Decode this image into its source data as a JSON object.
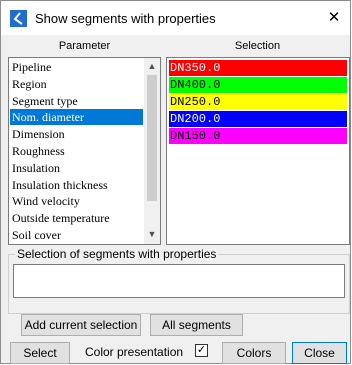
{
  "window": {
    "title": "Show segments with properties",
    "close_glyph": "✕"
  },
  "headers": {
    "parameter": "Parameter",
    "selection": "Selection"
  },
  "parameters": [
    "Pipeline",
    "Region",
    "Segment type",
    "Nom. diameter",
    "Dimension",
    "Roughness",
    "Insulation",
    "Insulation thickness",
    "Wind velocity",
    "Outside temperature",
    "Soil cover"
  ],
  "selected_parameter": "Nom. diameter",
  "selection_items": [
    {
      "label": "DN350.0",
      "bg": "#ff0000",
      "fg": "#ffffff"
    },
    {
      "label": "DN400.0",
      "bg": "#00ff00",
      "fg": "#000000"
    },
    {
      "label": "DN250.0",
      "bg": "#ffff00",
      "fg": "#000000"
    },
    {
      "label": "DN200.0",
      "bg": "#0000ff",
      "fg": "#ffffff"
    },
    {
      "label": "DN150.0",
      "bg": "#ff00ff",
      "fg": "#000000"
    }
  ],
  "group": {
    "legend": "Selection of segments with properties",
    "value": ""
  },
  "buttons": {
    "add_current": "Add current selection",
    "all_segments": "All segments",
    "select": "Select",
    "colors": "Colors",
    "close": "Close"
  },
  "color_presentation": {
    "label": "Color presentation",
    "checked": true,
    "check_glyph": "✓"
  },
  "icons": {
    "app": "app-logo-icon",
    "scroll_up": "▲",
    "scroll_down": "▼"
  }
}
